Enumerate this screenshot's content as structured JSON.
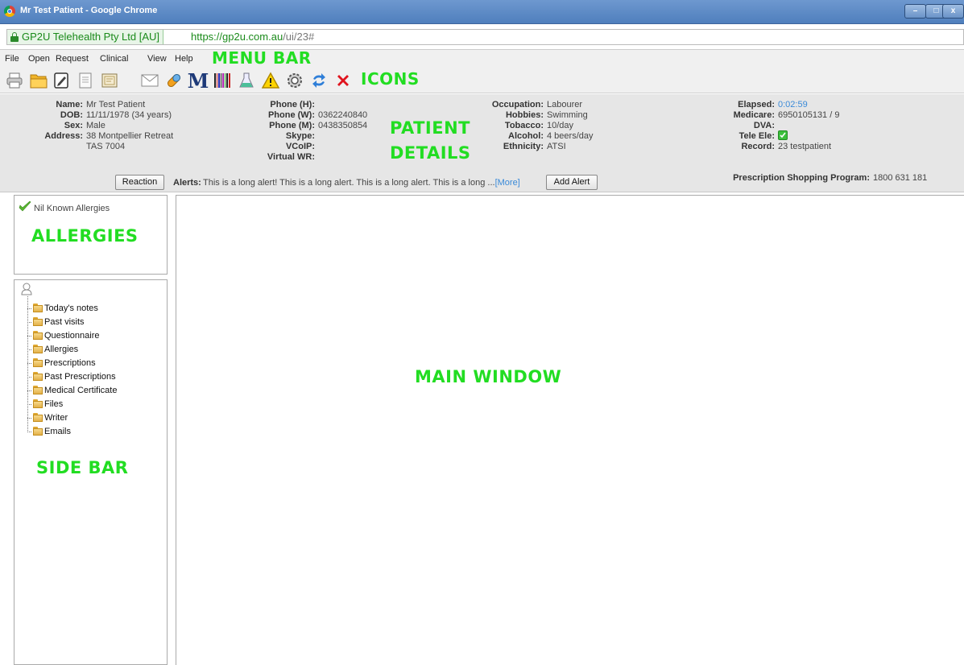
{
  "window": {
    "title": "Mr Test Patient - Google Chrome",
    "minimize_glyph": "–",
    "maximize_glyph": "□",
    "close_glyph": "x"
  },
  "address": {
    "site_identity": "GP2U Telehealth Pty Ltd [AU]",
    "url_host": "https://gp2u.com.au",
    "url_path": "/ui/23#"
  },
  "menu": {
    "items": [
      "File",
      "Open",
      "Request",
      "Clinical",
      "View",
      "Help"
    ],
    "annotation": "MENU BAR"
  },
  "toolbar": {
    "icons": [
      "printer-icon",
      "folder-open-icon",
      "edit-note-icon",
      "document-icon",
      "certificate-icon",
      "email-icon",
      "pill-icon",
      "medicare-m-icon",
      "barcode-icon",
      "lab-flask-icon",
      "warning-icon",
      "settings-gear-icon",
      "refresh-icon",
      "close-x-icon"
    ],
    "medicare_letter": "M",
    "annotation": "ICONS"
  },
  "patient": {
    "name_label": "Name:",
    "name": "Mr Test Patient",
    "dob_label": "DOB:",
    "dob": "11/11/1978 (34 years)",
    "sex_label": "Sex:",
    "sex": "Male",
    "address_label": "Address:",
    "address_line1": "38 Montpellier Retreat",
    "address_line2": "TAS 7004",
    "phone_h_label": "Phone (H):",
    "phone_h": "",
    "phone_w_label": "Phone (W):",
    "phone_w": "0362240840",
    "phone_m_label": "Phone (M):",
    "phone_m": "0438350854",
    "skype_label": "Skype:",
    "skype": "",
    "voip_label": "VCoIP:",
    "voip": "",
    "virtual_wr_label": "Virtual WR:",
    "virtual_wr": "",
    "occupation_label": "Occupation:",
    "occupation": "Labourer",
    "hobbies_label": "Hobbies:",
    "hobbies": "Swimming",
    "tobacco_label": "Tobacco:",
    "tobacco": "10/day",
    "alcohol_label": "Alcohol:",
    "alcohol": "4 beers/day",
    "ethnicity_label": "Ethnicity:",
    "ethnicity": "ATSI",
    "elapsed_label": "Elapsed:",
    "elapsed": "0:02:59",
    "medicare_label": "Medicare:",
    "medicare": "6950105131 / 9",
    "dva_label": "DVA:",
    "dva": "",
    "tele_ele_label": "Tele Ele:",
    "tele_ele_checked": true,
    "record_label": "Record:",
    "record": "23 testpatient",
    "psp_label": "Prescription Shopping Program:",
    "psp": "1800 631 181",
    "annotation_line1": "PATIENT",
    "annotation_line2": "DETAILS"
  },
  "alerts": {
    "reaction_button": "Reaction",
    "label": "Alerts:",
    "text": "This is a long alert! This is a long alert. This is a long alert. This is a long ...",
    "more_link": "[More]",
    "add_button": "Add Alert"
  },
  "allergies": {
    "status": "Nil Known Allergies",
    "annotation": "ALLERGIES"
  },
  "sidebar": {
    "items": [
      "Today's notes",
      "Past visits",
      "Questionnaire",
      "Allergies",
      "Prescriptions",
      "Past Prescriptions",
      "Medical Certificate",
      "Files",
      "Writer",
      "Emails"
    ],
    "annotation": "SIDE BAR"
  },
  "main": {
    "annotation": "MAIN WINDOW"
  },
  "colors": {
    "annotation_green": "#22dd22",
    "titlebar_blue": "#5a87c4",
    "link_blue": "#3a8ad8",
    "panel_gray": "#e6e6e6"
  }
}
